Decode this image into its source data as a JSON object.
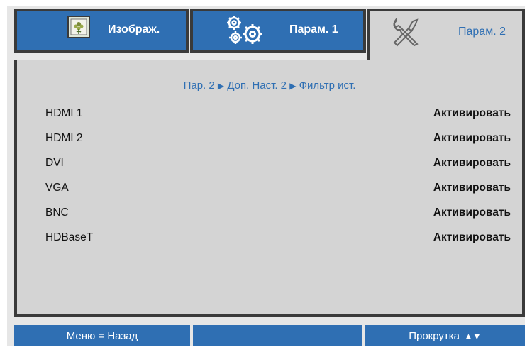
{
  "tabs": [
    {
      "label": "Изображ.",
      "icon": "picture-icon"
    },
    {
      "label": "Парам. 1",
      "icon": "gears-icon"
    },
    {
      "label": "Парам. 2",
      "icon": "tools-icon"
    }
  ],
  "breadcrumb": {
    "path1": "Пар. 2",
    "path2": "Доп. Наст. 2",
    "path3": "Фильтр ист.",
    "separator_icon": "triangle-right-icon"
  },
  "rows": [
    {
      "name": "HDMI 1",
      "value": "Активировать"
    },
    {
      "name": "HDMI 2",
      "value": "Активировать"
    },
    {
      "name": "DVI",
      "value": "Активировать"
    },
    {
      "name": "VGA",
      "value": "Активировать"
    },
    {
      "name": "BNC",
      "value": "Активировать"
    },
    {
      "name": "HDBaseT",
      "value": "Активировать"
    }
  ],
  "footer": {
    "left": "Меню = Назад",
    "middle": "",
    "right": "Прокрутка",
    "right_icon": "up-down-arrows-icon"
  },
  "colors": {
    "accent": "#2f6fb3",
    "panel": "#d4d4d4",
    "border": "#3a3a3a"
  }
}
